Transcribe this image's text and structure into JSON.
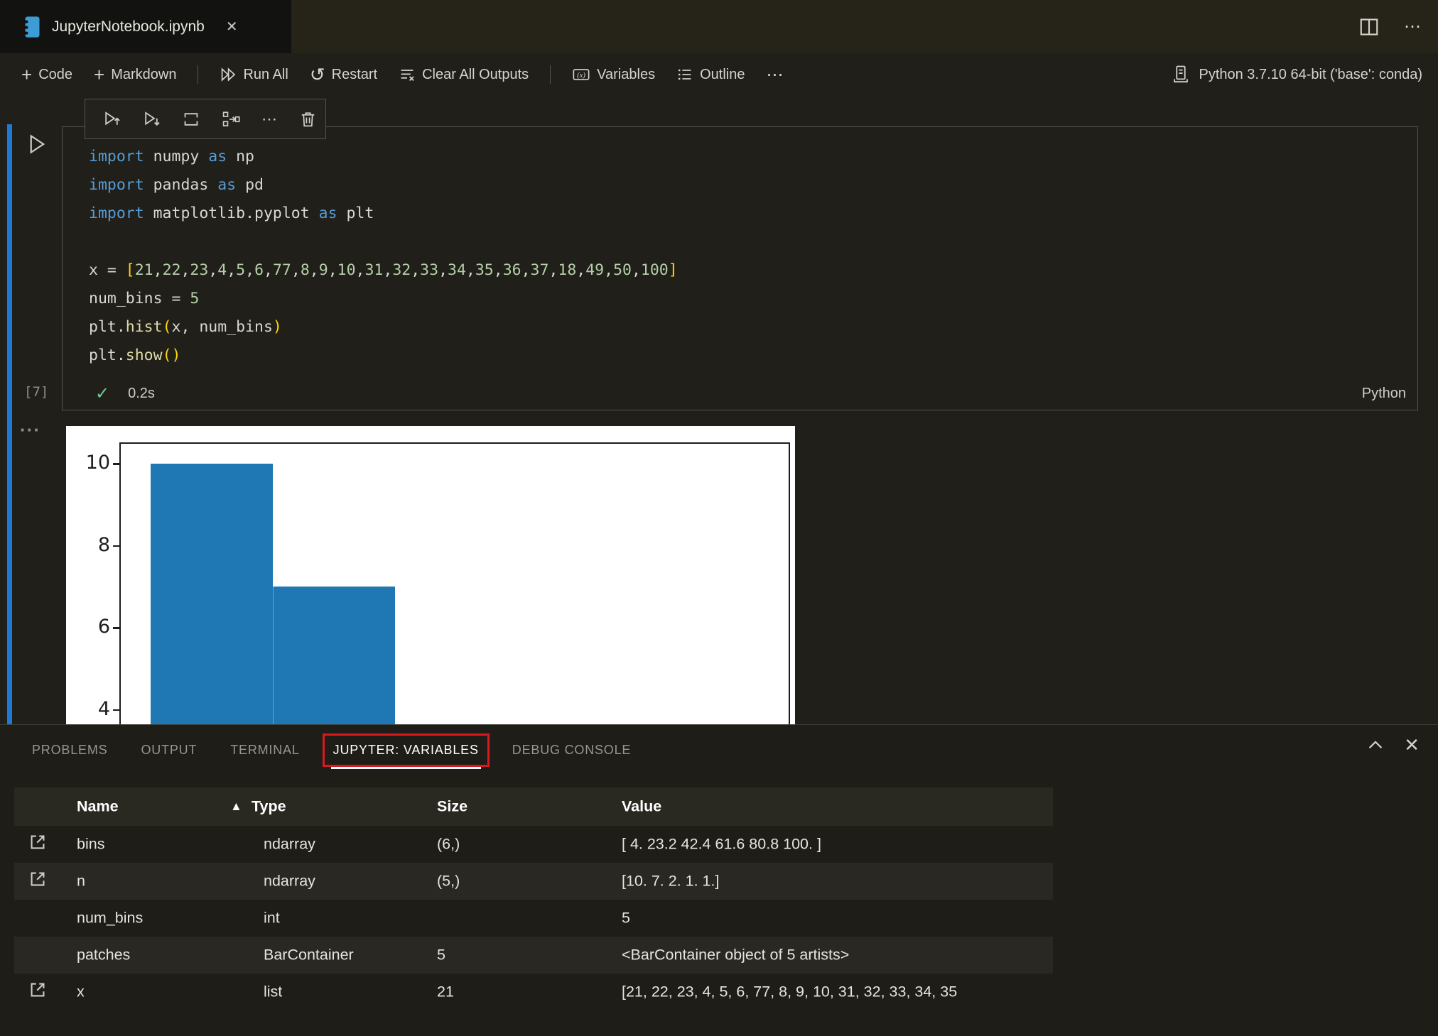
{
  "colors": {
    "accent_blue": "#1e7ad4",
    "keyword": "#569cd6",
    "plain": "#d8d8d4",
    "number": "#b5cea8",
    "bracket": "#ffd70a",
    "function": "#dcdcaa",
    "check_green": "#73c991",
    "bar_blue": "#1f77b4",
    "annotation_red": "#d91920"
  },
  "icons": {
    "more": "⋯",
    "output_more": "···",
    "close": "✕",
    "plus": "+",
    "restart": "↺",
    "sort_ascending": "▲"
  },
  "tab_bar": {
    "title": "JupyterNotebook.ipynb"
  },
  "toolbar": {
    "code": "Code",
    "markdown": "Markdown",
    "run_all": "Run All",
    "restart": "Restart",
    "clear_all_outputs": "Clear All Outputs",
    "variables": "Variables",
    "outline": "Outline",
    "kernel": "Python 3.7.10 64-bit ('base': conda)"
  },
  "cell": {
    "execution_count": "[7]",
    "check": "✓",
    "duration": "0.2s",
    "language": "Python",
    "code_lines": [
      [
        [
          "kw",
          "import"
        ],
        [
          "pl",
          " numpy "
        ],
        [
          "kw",
          "as"
        ],
        [
          "pl",
          " np"
        ]
      ],
      [
        [
          "kw",
          "import"
        ],
        [
          "pl",
          " pandas "
        ],
        [
          "kw",
          "as"
        ],
        [
          "pl",
          " pd"
        ]
      ],
      [
        [
          "kw",
          "import"
        ],
        [
          "pl",
          " matplotlib.pyplot "
        ],
        [
          "kw",
          "as"
        ],
        [
          "pl",
          " plt"
        ]
      ],
      [],
      [
        [
          "pl",
          "x = "
        ],
        [
          "br",
          "["
        ],
        [
          "num",
          "21"
        ],
        [
          "pl",
          ","
        ],
        [
          "num",
          "22"
        ],
        [
          "pl",
          ","
        ],
        [
          "num",
          "23"
        ],
        [
          "pl",
          ","
        ],
        [
          "num",
          "4"
        ],
        [
          "pl",
          ","
        ],
        [
          "num",
          "5"
        ],
        [
          "pl",
          ","
        ],
        [
          "num",
          "6"
        ],
        [
          "pl",
          ","
        ],
        [
          "num",
          "77"
        ],
        [
          "pl",
          ","
        ],
        [
          "num",
          "8"
        ],
        [
          "pl",
          ","
        ],
        [
          "num",
          "9"
        ],
        [
          "pl",
          ","
        ],
        [
          "num",
          "10"
        ],
        [
          "pl",
          ","
        ],
        [
          "num",
          "31"
        ],
        [
          "pl",
          ","
        ],
        [
          "num",
          "32"
        ],
        [
          "pl",
          ","
        ],
        [
          "num",
          "33"
        ],
        [
          "pl",
          ","
        ],
        [
          "num",
          "34"
        ],
        [
          "pl",
          ","
        ],
        [
          "num",
          "35"
        ],
        [
          "pl",
          ","
        ],
        [
          "num",
          "36"
        ],
        [
          "pl",
          ","
        ],
        [
          "num",
          "37"
        ],
        [
          "pl",
          ","
        ],
        [
          "num",
          "18"
        ],
        [
          "pl",
          ","
        ],
        [
          "num",
          "49"
        ],
        [
          "pl",
          ","
        ],
        [
          "num",
          "50"
        ],
        [
          "pl",
          ","
        ],
        [
          "num",
          "100"
        ],
        [
          "br",
          "]"
        ]
      ],
      [
        [
          "pl",
          "num_bins = "
        ],
        [
          "num",
          "5"
        ]
      ],
      [
        [
          "pl",
          "plt."
        ],
        [
          "fn",
          "hist"
        ],
        [
          "br",
          "("
        ],
        [
          "pl",
          "x, num_bins"
        ],
        [
          "br",
          ")"
        ]
      ],
      [
        [
          "pl",
          "plt."
        ],
        [
          "fn",
          "show"
        ],
        [
          "br",
          "("
        ],
        [
          "br",
          ")"
        ]
      ]
    ]
  },
  "chart_data": {
    "type": "bar",
    "title": "",
    "xlabel": "",
    "ylabel": "",
    "bin_edges": [
      4,
      23.2,
      42.4,
      61.6,
      80.8,
      100
    ],
    "counts": [
      10,
      7,
      2,
      1,
      1
    ],
    "yticks_visible": [
      10,
      8,
      6,
      4
    ],
    "ylim_visible": [
      3.9,
      10.9
    ],
    "grid": false,
    "legend": false,
    "bar_color": "#1f77b4",
    "background": "#ffffff"
  },
  "panel": {
    "tabs": [
      {
        "label": "PROBLEMS",
        "active": false,
        "highlighted": false
      },
      {
        "label": "OUTPUT",
        "active": false,
        "highlighted": false
      },
      {
        "label": "TERMINAL",
        "active": false,
        "highlighted": false
      },
      {
        "label": "JUPYTER: VARIABLES",
        "active": true,
        "highlighted": true
      },
      {
        "label": "DEBUG CONSOLE",
        "active": false,
        "highlighted": false
      }
    ],
    "table": {
      "headers": {
        "name": "Name",
        "type": "Type",
        "size": "Size",
        "value": "Value"
      },
      "rows": [
        {
          "has_icon": true,
          "name": "bins",
          "type": "ndarray",
          "size": "(6,)",
          "value": "[ 4. 23.2 42.4 61.6 80.8 100. ]",
          "striped": false
        },
        {
          "has_icon": true,
          "name": "n",
          "type": "ndarray",
          "size": "(5,)",
          "value": "[10. 7. 2. 1. 1.]",
          "striped": true
        },
        {
          "has_icon": false,
          "name": "num_bins",
          "type": "int",
          "size": "",
          "value": "5",
          "striped": false
        },
        {
          "has_icon": false,
          "name": "patches",
          "type": "BarContainer",
          "size": "5",
          "value": "<BarContainer object of 5 artists>",
          "striped": true
        },
        {
          "has_icon": true,
          "name": "x",
          "type": "list",
          "size": "21",
          "value": "[21, 22, 23, 4, 5, 6, 77, 8, 9, 10, 31, 32, 33, 34, 35",
          "striped": false
        }
      ]
    }
  }
}
